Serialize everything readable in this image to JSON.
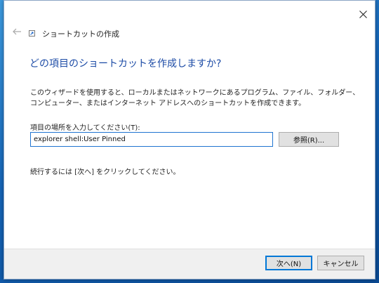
{
  "dialog": {
    "title": "ショートカットの作成",
    "heading": "どの項目のショートカットを作成しますか?",
    "description": "このウィザードを使用すると、ローカルまたはネットワークにあるプログラム、ファイル、フォルダー、コンピューター、またはインターネット アドレスへのショートカットを作成できます。",
    "field_label": "項目の場所を入力してください(T):",
    "location_value": "explorer shell:User Pinned",
    "browse_label": "参照(R)...",
    "instruction": "続行するには [次へ] をクリックしてください。"
  },
  "footer": {
    "next_label": "次へ(N)",
    "cancel_label": "キャンセル"
  },
  "icons": {
    "close": "close-icon",
    "back": "back-arrow-icon",
    "app": "shortcut-icon"
  },
  "colors": {
    "heading": "#1c4ba6",
    "input_border": "#1f74d1",
    "default_button_border": "#0078d7",
    "footer_bg": "#f0f0f0"
  }
}
